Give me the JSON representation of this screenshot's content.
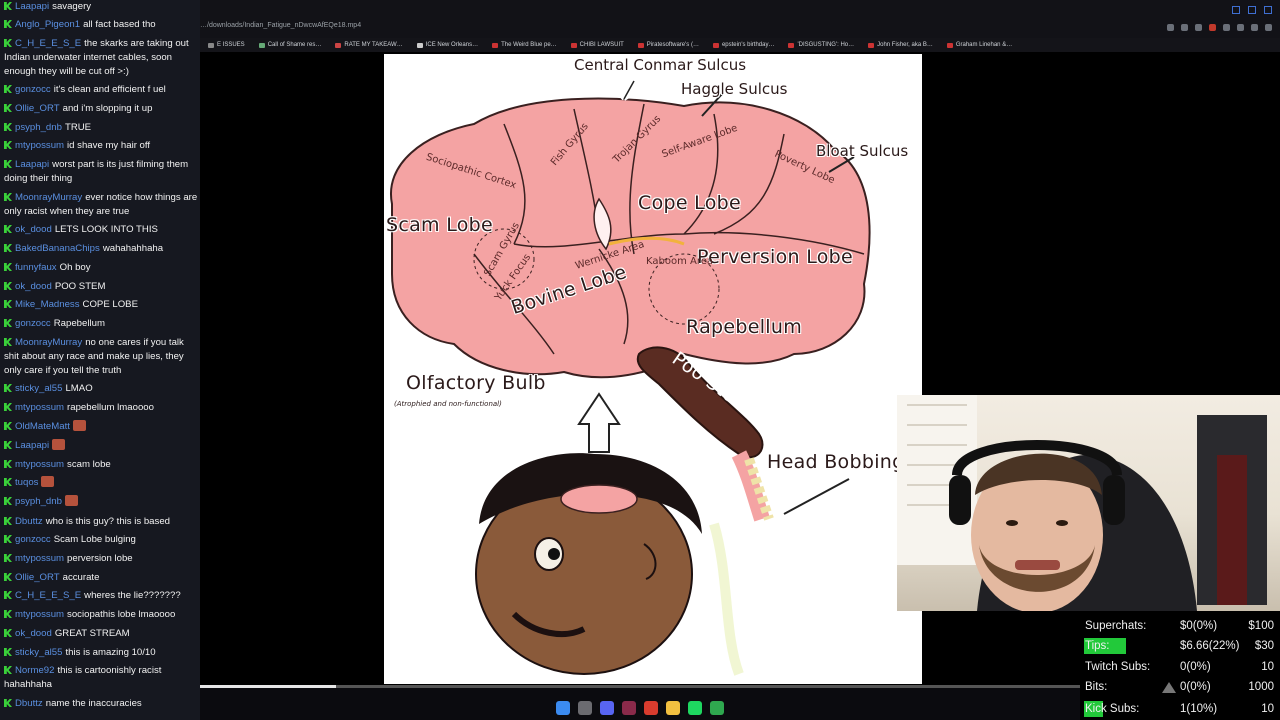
{
  "browser": {
    "url": "…/downloads/Indian_Fatigue_nDwcwAfEQe18.mp4",
    "bookmarks": [
      "E ISSUES",
      "Call of Shame res…",
      "RATE MY TAKEAW…",
      "ICE New Orleans…",
      "The Weird Blue pe…",
      "CHIBI LAWSUIT",
      "Piratesoftware's (…",
      "epstein's birthday…",
      "'DISGUSTING': Ho…",
      "John Fisher, aka B…",
      "Graham Linehan &…"
    ]
  },
  "meme": {
    "labels": {
      "central": "Central Conmar Sulcus",
      "haggle": "Haggle Sulcus",
      "bloat": "Bloat Sulcus",
      "scam": "Scam Lobe",
      "cope": "Cope Lobe",
      "perversion": "Perversion Lobe",
      "bovine": "Bovine Lobe",
      "rape": "Rapebellum",
      "olfactory": "Olfactory Bulb",
      "olfactory_sub": "(Atrophied and non-functional)",
      "poo": "Poo Stem",
      "head": "Head Bobbing",
      "sociopathic": "Sociopathic Cortex",
      "fish": "Fish Gyrus",
      "trojan": "Trojan Gyrus",
      "self": "Self-Aware Lobe",
      "poverty": "Poverty Lobe",
      "wernicke": "Wernicke Area",
      "kaboom": "Kaboom Area",
      "scam_gyrus": "Scam Gyrus",
      "yuck": "Yuck Focus"
    }
  },
  "chat": [
    {
      "user": "Laapapi",
      "msg": "savagery"
    },
    {
      "user": "Anglo_Pigeon1",
      "msg": "all fact based tho"
    },
    {
      "user": "C_H_E_E_S_E",
      "msg": "the skarks are taking out Indian underwater internet cables, soon enough they will be cut off >:)"
    },
    {
      "user": "gonzocc",
      "msg": "it's clean and efficient f uel"
    },
    {
      "user": "Ollie_ORT",
      "msg": "and i'm slopping it up"
    },
    {
      "user": "psyph_dnb",
      "msg": "TRUE"
    },
    {
      "user": "mtypossum",
      "msg": "id shave my hair off"
    },
    {
      "user": "Laapapi",
      "msg": "worst part is its just filming them doing their thing"
    },
    {
      "user": "MoonrayMurray",
      "msg": "ever notice how things are only racist when they are true"
    },
    {
      "user": "ok_dood",
      "msg": "LETS LOOK INTO THIS"
    },
    {
      "user": "BakedBananaChips",
      "msg": "wahahahhaha"
    },
    {
      "user": "funnyfaux",
      "msg": "Oh boy"
    },
    {
      "user": "ok_dood",
      "msg": "POO STEM"
    },
    {
      "user": "Mike_Madness",
      "msg": "COPE LOBE"
    },
    {
      "user": "gonzocc",
      "msg": "Rapebellum"
    },
    {
      "user": "MoonrayMurray",
      "msg": "no one cares if you talk shit about any race and make up lies, they only care if you tell the truth"
    },
    {
      "user": "sticky_al55",
      "msg": "LMAO"
    },
    {
      "user": "mtypossum",
      "msg": "rapebellum lmaoooo"
    },
    {
      "user": "OldMateMatt",
      "msg": ""
    },
    {
      "user": "Laapapi",
      "msg": ""
    },
    {
      "user": "mtypossum",
      "msg": "scam lobe"
    },
    {
      "user": "tuqos",
      "msg": ""
    },
    {
      "user": "psyph_dnb",
      "msg": ""
    },
    {
      "user": "Dbuttz",
      "msg": "who is this guy? this is based"
    },
    {
      "user": "gonzocc",
      "msg": "Scam Lobe bulging"
    },
    {
      "user": "mtypossum",
      "msg": "perversion lobe"
    },
    {
      "user": "Ollie_ORT",
      "msg": "accurate"
    },
    {
      "user": "C_H_E_E_S_E",
      "msg": "wheres the lie???????"
    },
    {
      "user": "mtypossum",
      "msg": "sociopathis lobe lmaoooo"
    },
    {
      "user": "ok_dood",
      "msg": "GREAT STREAM"
    },
    {
      "user": "sticky_al55",
      "msg": "this is amazing 10/10"
    },
    {
      "user": "Norme92",
      "msg": "this is cartoonishly racist hahahhaha"
    },
    {
      "user": "Dbuttz",
      "msg": "name the inaccuracies"
    }
  ],
  "overlay": {
    "superchats": {
      "label": "Superchats:",
      "value": "$0(0%)",
      "goal": "$100",
      "fill": 0
    },
    "tips": {
      "label": "Tips:",
      "value": "$6.66(22%)",
      "goal": "$30",
      "fill": 0.22
    },
    "twitch": {
      "label": "Twitch Subs:",
      "value": "0(0%)",
      "goal": "10",
      "fill": 0
    },
    "bits": {
      "label": "Bits:",
      "value": "0(0%)",
      "goal": "1000",
      "fill": 0
    },
    "kick": {
      "label": "Kick Subs:",
      "value": "1(10%)",
      "goal": "10",
      "fill": 0.1
    }
  },
  "colors": {
    "accent_green": "#22c93a",
    "username_blue": "#5a8fe0",
    "brain_pink": "#f08a8a"
  },
  "video_progress": 0.155
}
